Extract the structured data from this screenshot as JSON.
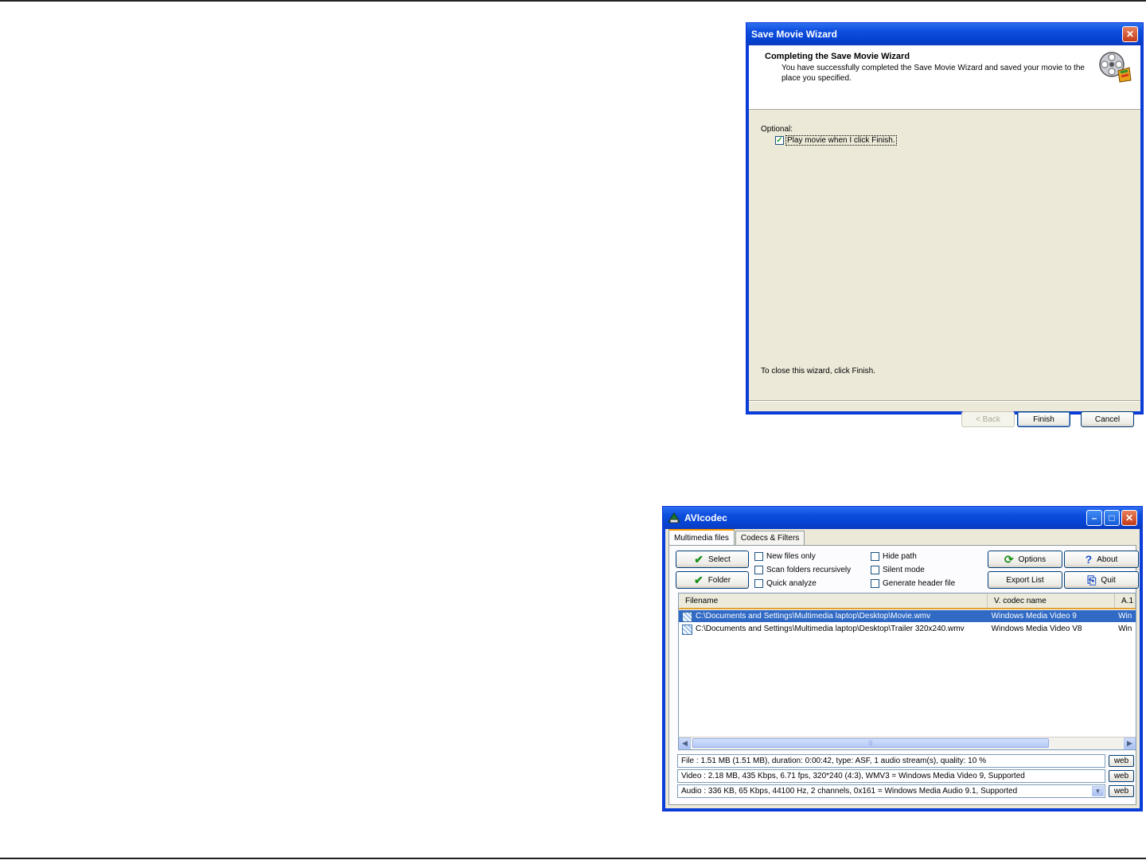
{
  "wizard": {
    "title": "Save Movie Wizard",
    "heading": "Completing the Save Movie Wizard",
    "subheading": "You have successfully completed the Save Movie Wizard and saved your movie to the place you specified.",
    "optional_label": "Optional:",
    "play_checkbox_label": "Play movie when I click Finish.",
    "play_checked": true,
    "close_hint": "To close this wizard, click Finish.",
    "back_label": "< Back",
    "finish_label": "Finish",
    "cancel_label": "Cancel"
  },
  "avicodec": {
    "title": "AVIcodec",
    "tabs": [
      {
        "label": "Multimedia files",
        "active": true
      },
      {
        "label": "Codecs & Filters",
        "active": false
      }
    ],
    "buttons": {
      "select": "Select",
      "folder": "Folder",
      "options": "Options",
      "about": "About",
      "export_list": "Export List",
      "quit": "Quit"
    },
    "options": {
      "new_files_only": "New files only",
      "scan_folders": "Scan folders recursively",
      "quick_analyze": "Quick analyze",
      "hide_path": "Hide path",
      "silent_mode": "Silent mode",
      "generate_header": "Generate header file"
    },
    "columns": [
      "Filename",
      "V. codec name",
      "A.1"
    ],
    "rows": [
      {
        "filename": "C:\\Documents and Settings\\Multimedia laptop\\Desktop\\Movie.wmv",
        "vcodec": "Windows Media Video 9",
        "acodec": "Win",
        "selected": true
      },
      {
        "filename": "C:\\Documents and Settings\\Multimedia laptop\\Desktop\\Trailer 320x240.wmv",
        "vcodec": "Windows Media Video V8",
        "acodec": "Win",
        "selected": false
      }
    ],
    "info": {
      "file": "File    :  1.51 MB (1.51 MB),  duration: 0:00:42,  type: ASF,  1 audio stream(s),  quality: 10 %",
      "video": "Video :  2.18 MB,  435 Kbps,  6.71 fps,  320*240 (4:3),  WMV3 = Windows Media Video 9,   Supported",
      "audio": "Audio :  336 KB,  65 Kbps,  44100 Hz,  2 channels,  0x161 = Windows Media Audio 9.1,   Supported"
    },
    "web_label": "web"
  }
}
